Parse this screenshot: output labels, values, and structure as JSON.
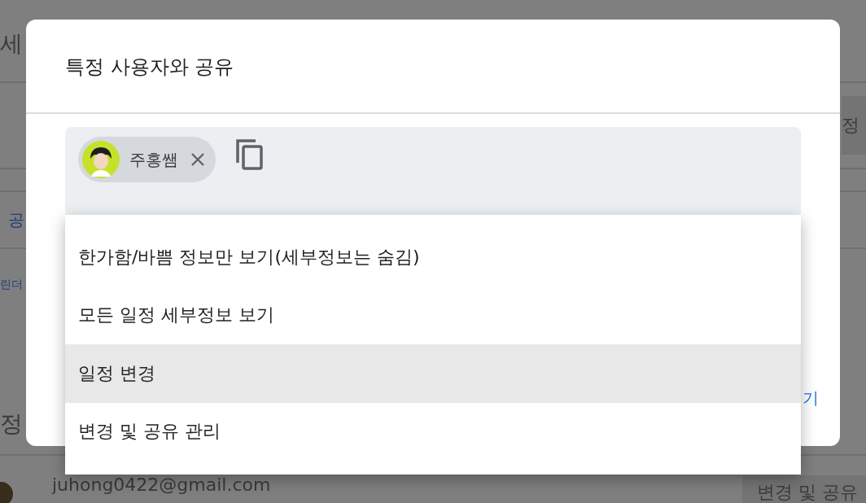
{
  "page": {
    "heading": "세",
    "link_1": "공",
    "link_2": "린더",
    "section_label": "정",
    "side_button": "정",
    "email": "juhong0422@gmail.com",
    "permission": "변경 및 공유"
  },
  "dialog": {
    "title": "특정 사용자와 공유",
    "recipients": [
      {
        "name": "주홍쌤"
      }
    ],
    "options": [
      {
        "label": "한가함/바쁨 정보만 보기(세부정보는 숨김)",
        "selected": false
      },
      {
        "label": "모든 일정 세부정보 보기",
        "selected": false
      },
      {
        "label": "일정 변경",
        "selected": true
      },
      {
        "label": "변경 및 공유 관리",
        "selected": false
      }
    ],
    "link": "기"
  }
}
